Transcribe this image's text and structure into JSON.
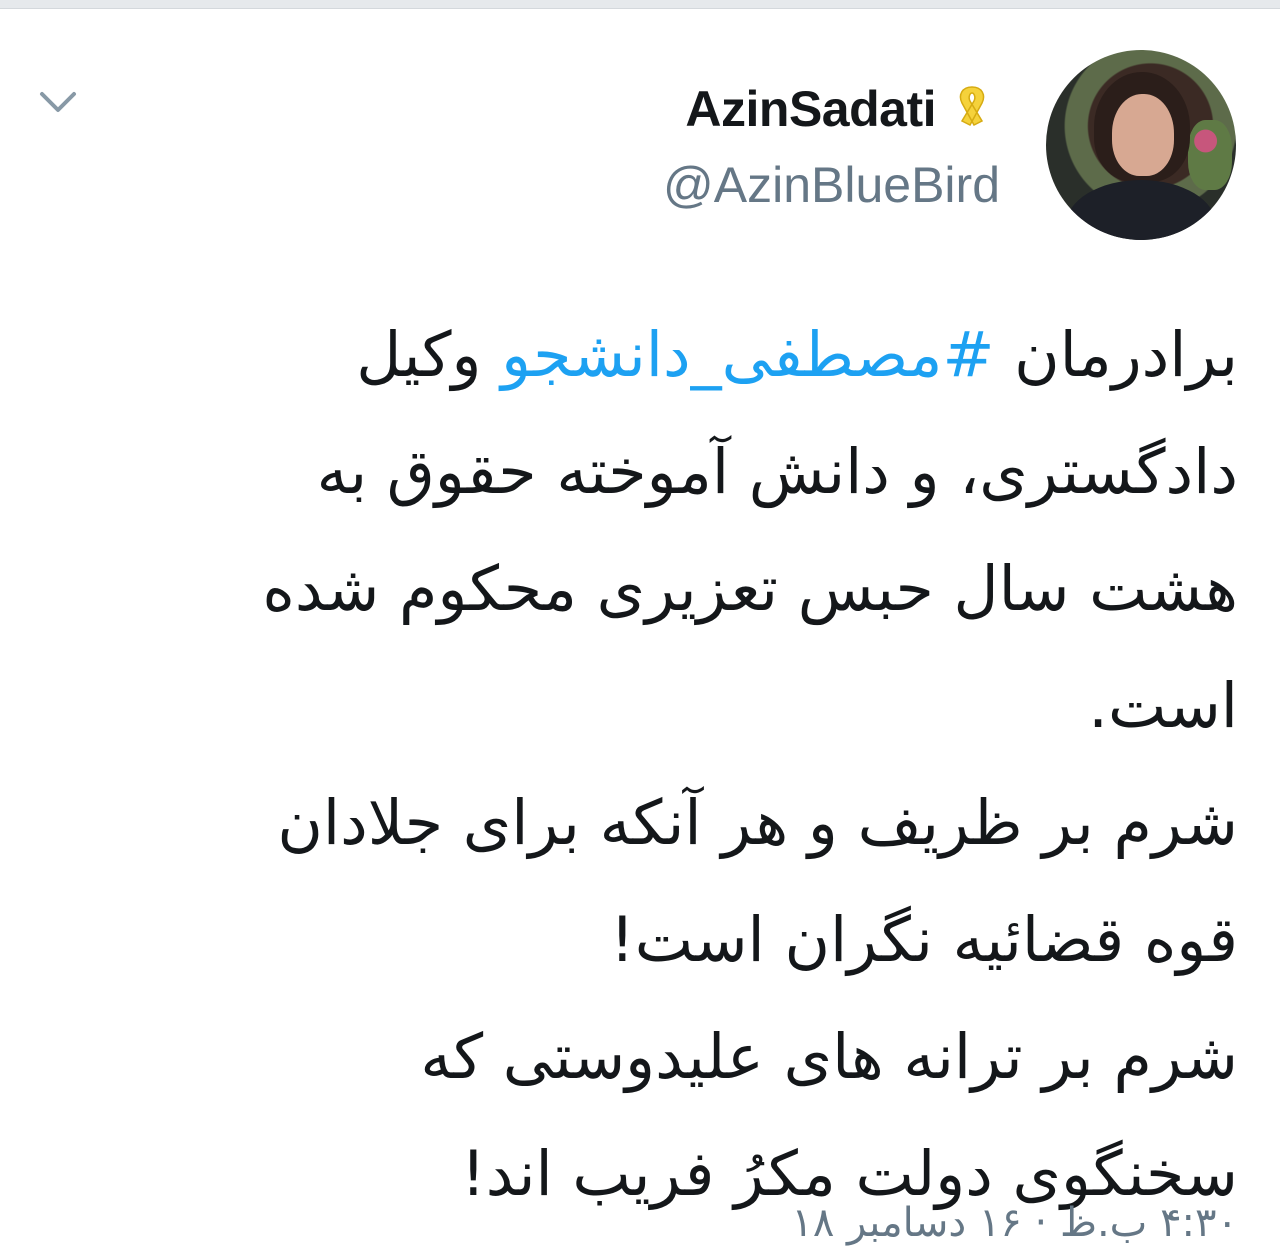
{
  "header": {
    "display_name": "AzinSadati",
    "handle": "@AzinBlueBird",
    "badge_icon": "yellow-ribbon-icon",
    "menu_icon": "chevron-down-icon"
  },
  "tweet": {
    "line1_prefix": "برادرمان ",
    "hashtag": "#مصطفی_دانشجو",
    "line1_suffix": " وکیل",
    "lines": [
      "دادگستری، و دانش آموخته حقوق به",
      "هشت سال حبس تعزیری محکوم شده",
      "است.",
      "شرم بر ظریف و هر آنکه برای جلادان",
      "قوه قضائیه  نگران است!",
      "شرم بر ترانه های علیدوستی که",
      "سخنگوی دولت مکرُ فریب اند!"
    ]
  },
  "footer": {
    "timestamp": "۴:۳۰ ب.ظ · ۱۶ دسامبر ۱۸"
  },
  "colors": {
    "link": "#1da1f2",
    "secondary_text": "#657786",
    "ribbon": "#f5d23b"
  }
}
